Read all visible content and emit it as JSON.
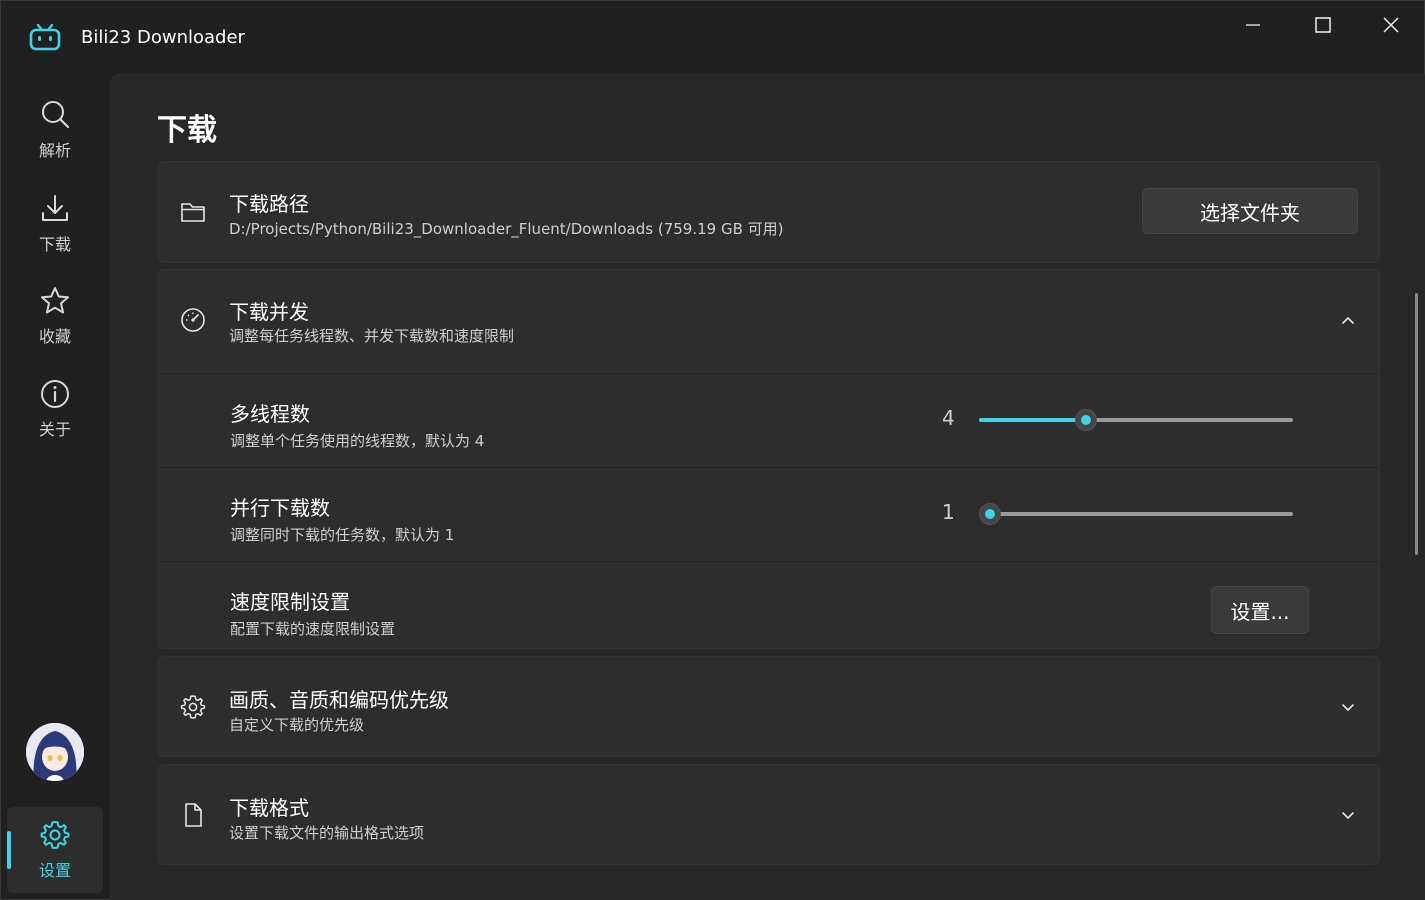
{
  "window": {
    "title": "Bili23 Downloader",
    "icons": {
      "logo": "bilibili-tv-icon",
      "minimize": "minimize-icon",
      "maximize": "maximize-icon",
      "close": "close-icon"
    }
  },
  "sidebar": {
    "items": [
      {
        "id": "parse",
        "label": "解析",
        "icon": "search-icon"
      },
      {
        "id": "download",
        "label": "下载",
        "icon": "download-icon"
      },
      {
        "id": "favorites",
        "label": "收藏",
        "icon": "star-icon"
      },
      {
        "id": "about",
        "label": "关于",
        "icon": "info-icon"
      },
      {
        "id": "settings",
        "label": "设置",
        "icon": "gear-icon",
        "selected": true
      }
    ]
  },
  "page": {
    "title": "下载"
  },
  "download_path": {
    "icon": "folder-icon",
    "title": "下载路径",
    "path": "D:/Projects/Python/Bili23_Downloader_Fluent/Downloads (759.19 GB 可用)",
    "button_label": "选择文件夹"
  },
  "concurrency": {
    "icon": "speedometer-icon",
    "title": "下载并发",
    "description": "调整每任务线程数、并发下载数和速度限制",
    "expanded": true,
    "threads": {
      "title": "多线程数",
      "description": "调整单个任务使用的线程数，默认为 4",
      "value": "4",
      "fraction": 0.33
    },
    "parallel": {
      "title": "并行下载数",
      "description": "调整同时下载的任务数，默认为 1",
      "value": "1",
      "fraction": 0.0
    },
    "speed_limit": {
      "title": "速度限制设置",
      "description": "配置下载的速度限制设置",
      "button_label": "设置..."
    }
  },
  "quality": {
    "icon": "gear-icon",
    "title": "画质、音质和编码优先级",
    "description": "自定义下载的优先级"
  },
  "format": {
    "icon": "document-icon",
    "title": "下载格式",
    "description": "设置下载文件的输出格式选项"
  },
  "colors": {
    "accent": "#3fd4e8",
    "background": "#202020",
    "panel": "#272727",
    "card": "#2d2d2d"
  }
}
